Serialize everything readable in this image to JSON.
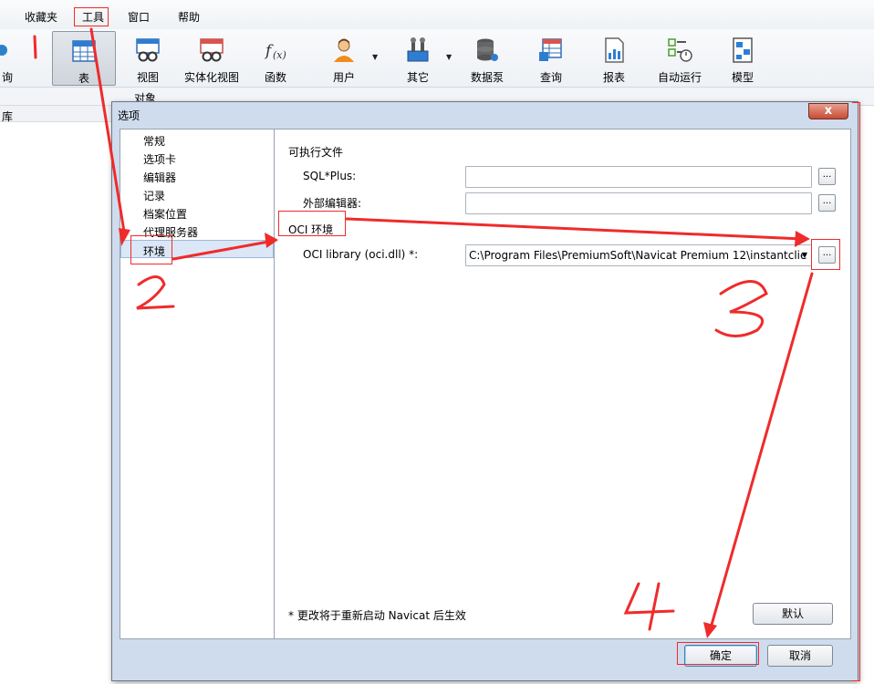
{
  "menu": {
    "favorites": "收藏夹",
    "tools": "工具",
    "window": "窗口",
    "help": "帮助"
  },
  "toolbar": {
    "query_partial": "询",
    "items": [
      "表",
      "视图",
      "实体化视图",
      "函数",
      "用户",
      "其它",
      "数据泵",
      "查询",
      "报表",
      "自动运行",
      "模型"
    ]
  },
  "tabs": {
    "objects": "对象"
  },
  "left_panel": {
    "header_partial": "库"
  },
  "dialog": {
    "title": "选项",
    "close": "x",
    "nav": [
      "常规",
      "选项卡",
      "编辑器",
      "记录",
      "档案位置",
      "代理服务器",
      "环境"
    ],
    "sections": {
      "executables": "可执行文件",
      "oci_env": "OCI 环境"
    },
    "labels": {
      "sqlplus": "SQL*Plus:",
      "external_editor": "外部编辑器:",
      "oci_library": "OCI library (oci.dll) *:"
    },
    "values": {
      "sqlplus": "",
      "external_editor": "",
      "oci_library": "C:\\Program Files\\PremiumSoft\\Navicat Premium 12\\instantclie"
    },
    "browse": "...",
    "note": "* 更改将于重新启动 Navicat 后生效",
    "buttons": {
      "default": "默认",
      "ok": "确定",
      "cancel": "取消"
    }
  },
  "annotation_color": "#ef2b2b"
}
